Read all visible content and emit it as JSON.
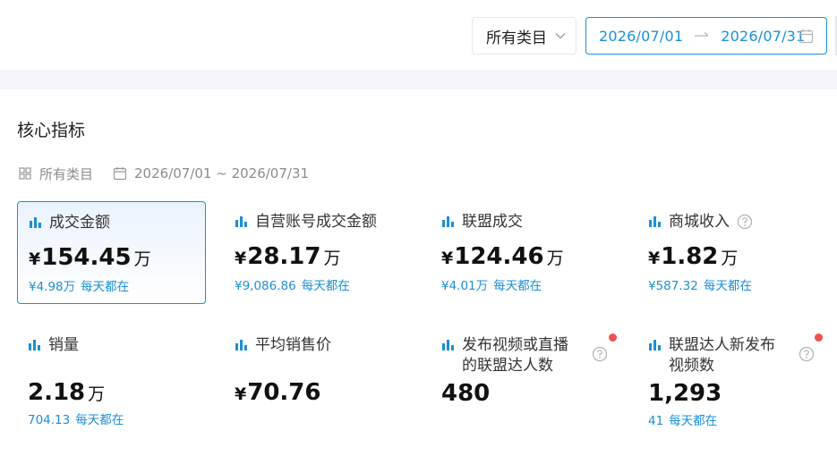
{
  "header": {
    "category_select": "所有类目",
    "date_start": "2026/07/01",
    "date_end": "2026/07/31"
  },
  "section": {
    "title": "核心指标",
    "filter_category": "所有类目",
    "filter_date": "2026/07/01 ~ 2026/07/31"
  },
  "colors": {
    "accent": "#1b8fd6",
    "dot": "#f05050"
  },
  "metrics": [
    {
      "name": "成交金额",
      "yen": "¥",
      "value": "154.45",
      "unit": "万",
      "sub_value": "¥4.98万",
      "sub_suffix": "每天都在"
    },
    {
      "name": "自营账号成交金额",
      "yen": "¥",
      "value": "28.17",
      "unit": "万",
      "sub_value": "¥9,086.86",
      "sub_suffix": "每天都在"
    },
    {
      "name": "联盟成交",
      "yen": "¥",
      "value": "124.46",
      "unit": "万",
      "sub_value": "¥4.01万",
      "sub_suffix": "每天都在"
    },
    {
      "name": "商城收入",
      "yen": "¥",
      "value": "1.82",
      "unit": "万",
      "sub_value": "¥587.32",
      "sub_suffix": "每天都在"
    },
    {
      "name": "销量",
      "yen": "",
      "value": "2.18",
      "unit": "万",
      "sub_value": "704.13",
      "sub_suffix": "每天都在"
    },
    {
      "name": "平均销售价",
      "yen": "¥",
      "value": "70.76",
      "unit": "",
      "sub_value": "",
      "sub_suffix": ""
    },
    {
      "name": "发布视频或直播的联盟达人数",
      "name_line1": "发布视频或直播",
      "name_line2": "的联盟达人数",
      "yen": "",
      "value": "480",
      "unit": "",
      "sub_value": "",
      "sub_suffix": ""
    },
    {
      "name": "联盟达人新发布视频数",
      "name_line1": "联盟达人新发布",
      "name_line2": "视频数",
      "yen": "",
      "value": "1,293",
      "unit": "",
      "sub_value": "41",
      "sub_suffix": "每天都在"
    }
  ]
}
